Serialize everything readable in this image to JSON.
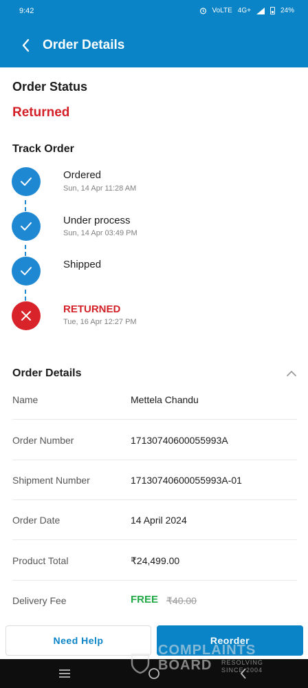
{
  "status_bar": {
    "time": "9:42",
    "network_1": "VoLTE",
    "network_2": "4G+",
    "battery": "24%"
  },
  "header": {
    "title": "Order Details",
    "back_icon": "chevron-left-icon"
  },
  "order_status": {
    "heading": "Order Status",
    "value": "Returned"
  },
  "track": {
    "heading": "Track Order",
    "steps": [
      {
        "label": "Ordered",
        "date": "Sun, 14 Apr 11:28 AM",
        "state": "done"
      },
      {
        "label": "Under process",
        "date": "Sun, 14 Apr 03:49 PM",
        "state": "done"
      },
      {
        "label": "Shipped",
        "date": "",
        "state": "done"
      },
      {
        "label": "RETURNED",
        "date": "Tue, 16 Apr 12:27 PM",
        "state": "failed"
      }
    ]
  },
  "details": {
    "heading": "Order Details",
    "rows": [
      {
        "label": "Name",
        "value": "Mettela Chandu"
      },
      {
        "label": "Order Number",
        "value": "17130740600055993A"
      },
      {
        "label": "Shipment Number",
        "value": "17130740600055993A-01"
      },
      {
        "label": "Order Date",
        "value": "14 April 2024"
      },
      {
        "label": "Product Total",
        "value": "₹24,499.00"
      },
      {
        "label": "Delivery Fee",
        "free_text": "FREE",
        "original_fee": "₹40.00"
      }
    ]
  },
  "actions": {
    "help_label": "Need Help",
    "reorder_label": "Reorder"
  },
  "watermark": {
    "line1": "COMPLAINTS",
    "line2": "BOARD",
    "tag1": "RESOLVING",
    "tag2": "SINCE 2004"
  },
  "colors": {
    "primary": "#0a84c6",
    "step_done": "#1e88d2",
    "step_failed": "#d72329",
    "returned_text": "#d32027",
    "free_text": "#20a845"
  }
}
